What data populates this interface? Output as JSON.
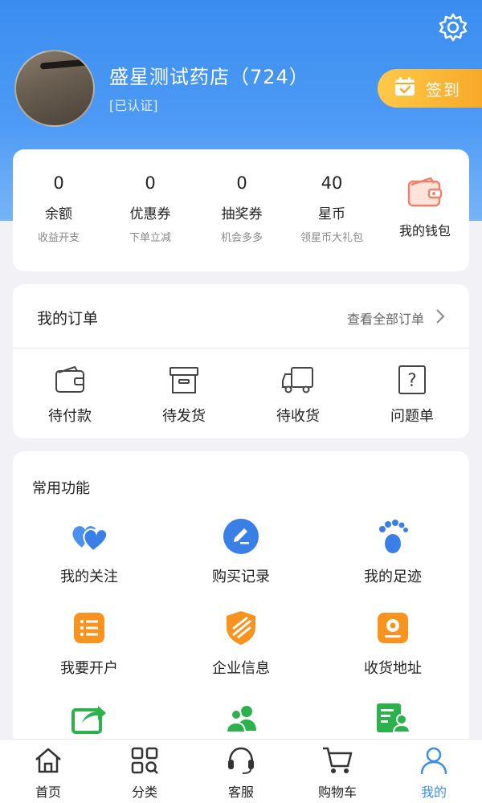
{
  "profile": {
    "shop_name": "盛星测试药店（724）",
    "verified": "[已认证]",
    "checkin": "签到"
  },
  "stats": [
    {
      "value": "0",
      "name": "余额",
      "sub": "收益开支"
    },
    {
      "value": "0",
      "name": "优惠券",
      "sub": "下单立减"
    },
    {
      "value": "0",
      "name": "抽奖券",
      "sub": "机会多多"
    },
    {
      "value": "40",
      "name": "星币",
      "sub": "领星币大礼包"
    }
  ],
  "wallet": {
    "label": "我的钱包"
  },
  "orders": {
    "title": "我的订单",
    "view_all": "查看全部订单",
    "items": [
      {
        "label": "待付款",
        "icon": "wallet-icon"
      },
      {
        "label": "待发货",
        "icon": "box-icon"
      },
      {
        "label": "待收货",
        "icon": "truck-icon"
      },
      {
        "label": "问题单",
        "icon": "question-icon"
      }
    ]
  },
  "functions": {
    "title": "常用功能",
    "items": [
      {
        "label": "我的关注",
        "icon": "hearts-icon"
      },
      {
        "label": "购买记录",
        "icon": "edit-icon"
      },
      {
        "label": "我的足迹",
        "icon": "footprint-icon"
      },
      {
        "label": "我要开户",
        "icon": "list-icon"
      },
      {
        "label": "企业信息",
        "icon": "shield-icon"
      },
      {
        "label": "收货地址",
        "icon": "location-icon"
      }
    ]
  },
  "tabs": [
    {
      "label": "首页",
      "icon": "home-icon"
    },
    {
      "label": "分类",
      "icon": "category-icon"
    },
    {
      "label": "客服",
      "icon": "headset-icon"
    },
    {
      "label": "购物车",
      "icon": "cart-icon"
    },
    {
      "label": "我的",
      "icon": "user-icon"
    }
  ],
  "colors": {
    "accent": "#3a8df0",
    "checkin": "#f7a928",
    "orange": "#f7931e",
    "green": "#2bb24c"
  }
}
